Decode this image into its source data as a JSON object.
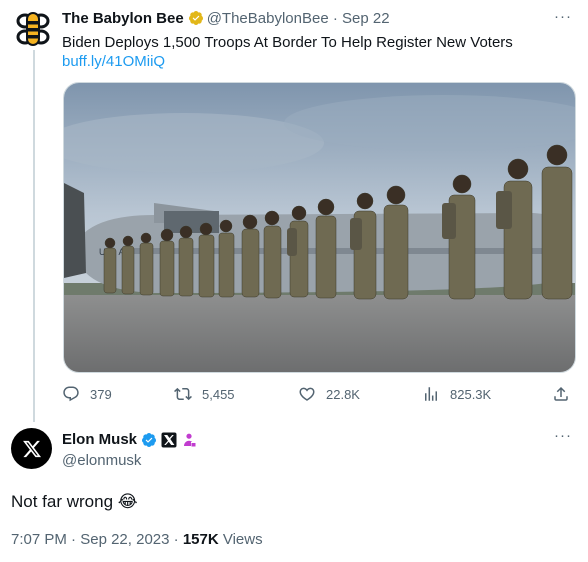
{
  "quoted_tweet": {
    "author_name": "The Babylon Bee",
    "author_handle": "@TheBabylonBee",
    "separator": "·",
    "date": "Sep 22",
    "text": "Biden Deploys 1,500 Troops At Border To Help Register New Voters",
    "link": "buff.ly/41OMiiQ",
    "more_glyph": "···",
    "stats": {
      "replies": "379",
      "retweets": "5,455",
      "likes": "22.8K",
      "views": "825.3K"
    },
    "avatar_icon": "bee-logo-icon",
    "verified_color": "#e2b719"
  },
  "main_tweet": {
    "author_name": "Elon Musk",
    "author_handle": "@elonmusk",
    "text": "Not far wrong 😂",
    "time": "7:07 PM",
    "dot": "·",
    "date": "Sep 22, 2023",
    "views_count": "157K",
    "views_label": "Views",
    "more_glyph": "···",
    "verified_color": "#1d9bf0",
    "avatar_icon": "x-logo-icon"
  },
  "colors": {
    "link": "#1d9bf0",
    "secondary_text": "#536471",
    "primary_text": "#0f1419",
    "divider": "#cfd9de"
  }
}
